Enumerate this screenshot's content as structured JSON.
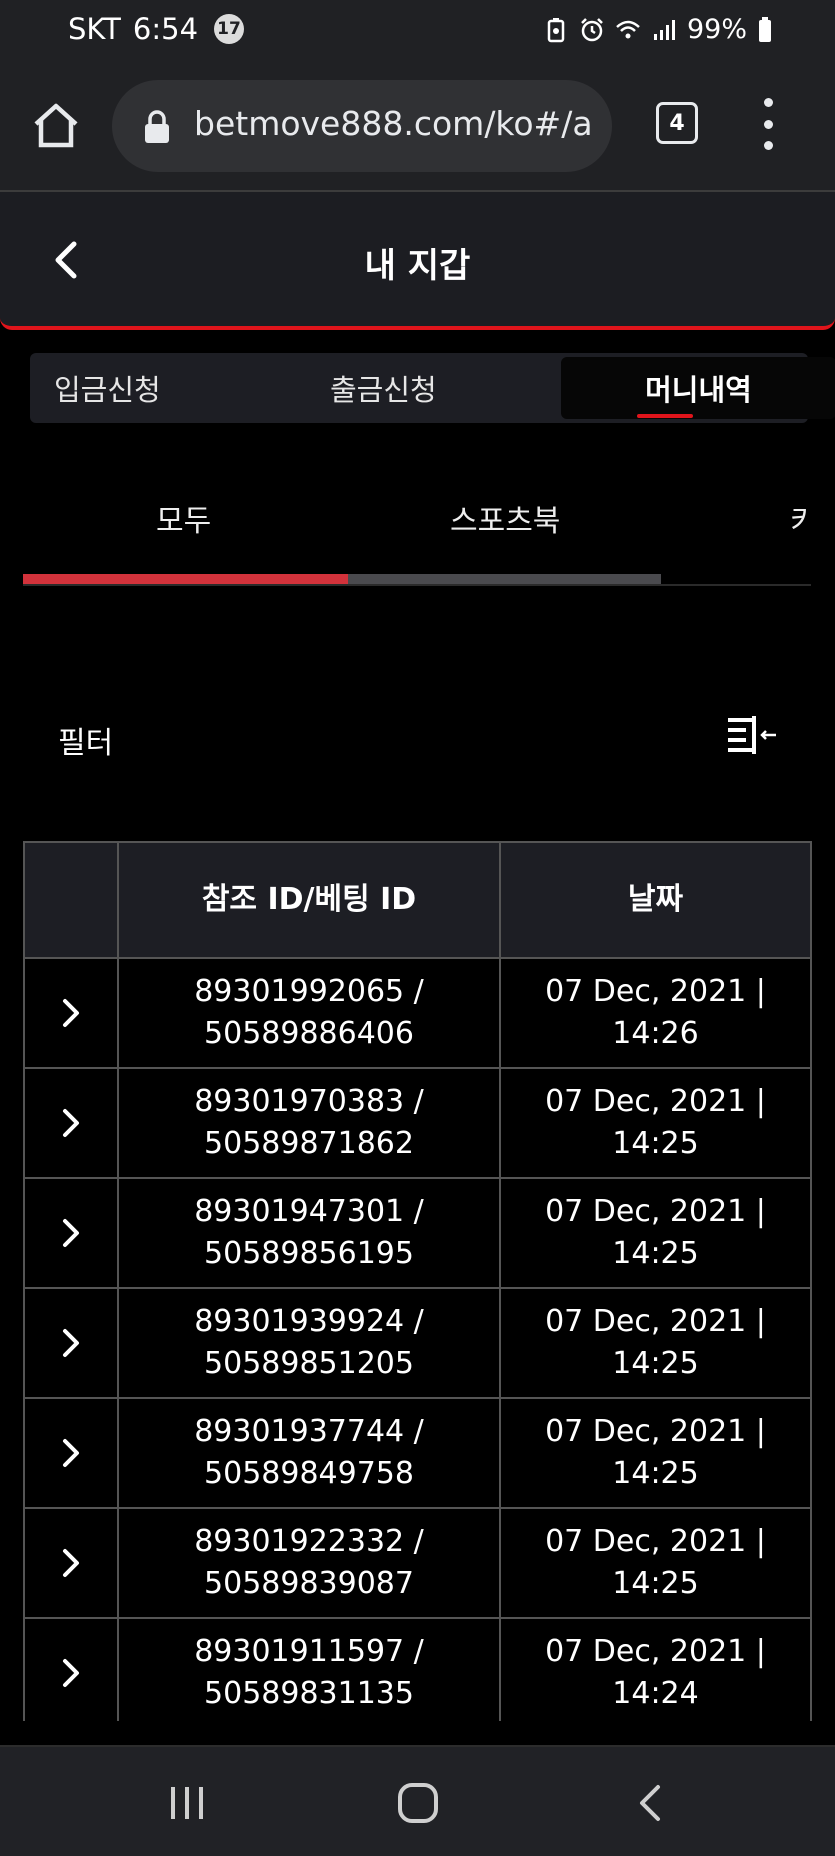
{
  "status_bar": {
    "carrier": "SKT",
    "time": "6:54",
    "notification_count": "17",
    "battery": "99%"
  },
  "browser": {
    "url": "betmove888.com/ko#/a",
    "tab_count": "4"
  },
  "header": {
    "title": "내 지갑"
  },
  "wallet_tabs": [
    {
      "label": "입금신청",
      "active": false
    },
    {
      "label": "출금신청",
      "active": false
    },
    {
      "label": "머니내역",
      "active": true
    }
  ],
  "category_tabs": [
    {
      "label": "모두",
      "active": true
    },
    {
      "label": "스포츠북",
      "active": false
    },
    {
      "label": "키",
      "active": false
    }
  ],
  "filter": {
    "label": "필터",
    "icon": "filter-collapse-icon"
  },
  "table": {
    "headers": [
      "",
      "참조 ID/베팅 ID",
      "날짜"
    ],
    "rows": [
      {
        "ref": "89301992065 /",
        "bet": "50589886406",
        "date": "07 Dec, 2021 |",
        "time": "14:26"
      },
      {
        "ref": "89301970383 /",
        "bet": "50589871862",
        "date": "07 Dec, 2021 |",
        "time": "14:25"
      },
      {
        "ref": "89301947301 /",
        "bet": "50589856195",
        "date": "07 Dec, 2021 |",
        "time": "14:25"
      },
      {
        "ref": "89301939924 /",
        "bet": "50589851205",
        "date": "07 Dec, 2021 |",
        "time": "14:25"
      },
      {
        "ref": "89301937744 /",
        "bet": "50589849758",
        "date": "07 Dec, 2021 |",
        "time": "14:25"
      },
      {
        "ref": "89301922332 /",
        "bet": "50589839087",
        "date": "07 Dec, 2021 |",
        "time": "14:25"
      },
      {
        "ref": "89301911597 /",
        "bet": "50589831135",
        "date": "07 Dec, 2021 |",
        "time": "14:24"
      }
    ]
  },
  "colors": {
    "accent_red": "#e0141b",
    "progress_red": "#d2323b",
    "background": "#000000",
    "panel": "#1d1e24"
  }
}
